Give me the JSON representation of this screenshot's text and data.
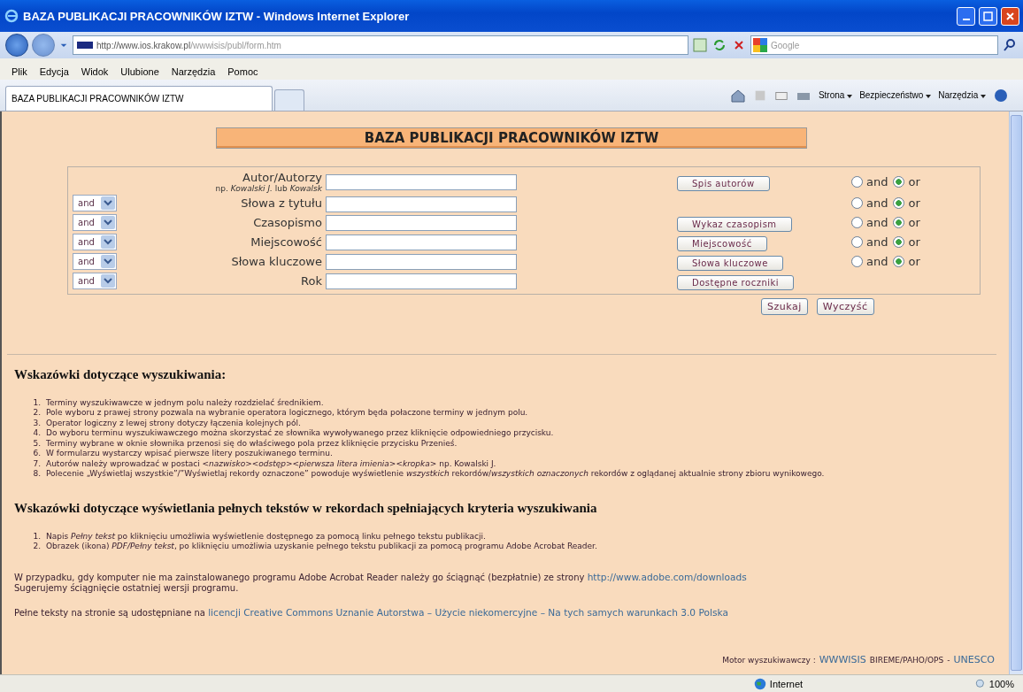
{
  "window": {
    "title": "BAZA PUBLIKACJI PRACOWNIKÓW IZTW - Windows Internet Explorer"
  },
  "address_bar": {
    "host": "http://www.ios.krakow.pl",
    "path": "/wwwisis/publ/form.htm"
  },
  "search_box": {
    "placeholder": "Google"
  },
  "menu": [
    "Plik",
    "Edycja",
    "Widok",
    "Ulubione",
    "Narzędzia",
    "Pomoc"
  ],
  "tabs": [
    {
      "label": "BAZA PUBLIKACJI PRACOWNIKÓW IZTW",
      "selected": true
    }
  ],
  "command_bar": [
    "Strona",
    "Bezpieczeństwo",
    "Narzędzia"
  ],
  "page": {
    "title": "BAZA PUBLIKACJI PRACOWNIKÓW IZTW",
    "form": {
      "rows": [
        {
          "label": "Autor/Autorzy",
          "hint": "np. *Kowalski J.* lub *Kowalsk*",
          "button": "Spis autorów",
          "radios": [
            {
              "label": "and",
              "selected": false
            },
            {
              "label": "or",
              "selected": true
            }
          ]
        },
        {
          "operator": "and",
          "label": "Słowa z tytułu",
          "radios": [
            {
              "label": "and",
              "selected": false
            },
            {
              "label": "or",
              "selected": true
            }
          ]
        },
        {
          "operator": "and",
          "label": "Czasopismo",
          "button": "Wykaz czasopism",
          "radios": [
            {
              "label": "and",
              "selected": false
            },
            {
              "label": "or",
              "selected": true
            }
          ]
        },
        {
          "operator": "and",
          "label": "Miejscowość",
          "button": "Miejscowość",
          "radios": [
            {
              "label": "and",
              "selected": false
            },
            {
              "label": "or",
              "selected": true
            }
          ]
        },
        {
          "operator": "and",
          "label": "Słowa kluczowe",
          "button": "Słowa kluczowe",
          "radios": [
            {
              "label": "and",
              "selected": false
            },
            {
              "label": "or",
              "selected": true
            }
          ]
        },
        {
          "operator": "and",
          "label": "Rok",
          "button": "Dostępne roczniki"
        }
      ],
      "actions": [
        "Szukaj",
        "Wyczyść"
      ]
    },
    "sections": [
      {
        "heading": "Wskazówki dotyczące wyszukiwania:",
        "items": [
          {
            "number": "1.",
            "text": "Terminy wyszukiwawcze w jednym polu należy rozdzielać średnikiem."
          },
          {
            "number": "2.",
            "text": "Pole wyboru z prawej strony pozwala na wybranie operatora logicznego, którym będa połaczone terminy w jednym polu."
          },
          {
            "number": "3.",
            "text": "Operator logiczny z lewej strony dotyczy łączenia kolejnych pól."
          },
          {
            "number": "4.",
            "text": "Do wyboru terminu wyszukiwawczego można skorzystać ze słownika wywoływanego przez kliknięcie odpowiedniego przycisku."
          },
          {
            "number": "5.",
            "text": "Terminy wybrane w oknie słownika przenosi się do właściwego pola przez kliknięcie przycisku Przenieś."
          },
          {
            "number": "6.",
            "text": "W formularzu wystarczy wpisać pierwsze litery poszukiwanego terminu."
          },
          {
            "number": "7.",
            "text": "Autorów należy wprowadzać w postaci *<nazwisko><odstęp><pierwsza litera imienia><kropka>* np. Kowalski J."
          },
          {
            "number": "8.",
            "text": "Polecenie „Wyświetlaj wszystkie”/”Wyświetlaj rekordy oznaczone” powoduje wyświetlenie *wszystkich* rekordów/*wszystkich oznaczonych* rekordów z oglądanej aktualnie strony zbioru wynikowego."
          }
        ]
      },
      {
        "heading": "Wskazówki dotyczące wyświetlania pełnych tekstów w rekordach spełniających kryteria wyszukiwania",
        "items": [
          {
            "number": "1.",
            "text": "Napis *Pełny tekst* po kliknięciu umożliwia wyświetlenie dostępnego za pomocą linku pełnego tekstu publikacji."
          },
          {
            "number": "2.",
            "text": "Obrazek (ikona) *PDF/Pełny tekst*, po kliknięciu umożliwia uzyskanie pełnego tekstu publikacji za pomocą programu Adobe Acrobat Reader."
          }
        ]
      }
    ],
    "notes": [
      {
        "lines": [
          {
            "text": "W przypadku, gdy komputer nie ma zainstalowanego programu Adobe Acrobat Reader należy go ściągnąć (bezpłatnie) ze strony ",
            "link": "http://www.adobe.com/downloads"
          },
          {
            "text": "Sugerujemy ściągnięcie ostatniej wersji programu."
          }
        ]
      },
      {
        "lines": [
          {
            "text": "Pełne teksty na stronie są udostępniane na ",
            "link": "licencji Creative Commons Uznanie Autorstwa – Użycie niekomercyjne – Na tych samych warunkach 3.0 Polska"
          }
        ]
      }
    ],
    "footer": {
      "label": "Motor wyszukiwawczy :",
      "engine": "WWWISIS",
      "credit": "BIREME/PAHO/OPS",
      "separator": "-",
      "org": "UNESCO"
    }
  },
  "status_bar": {
    "zone": "Internet",
    "zoom": "100%"
  }
}
